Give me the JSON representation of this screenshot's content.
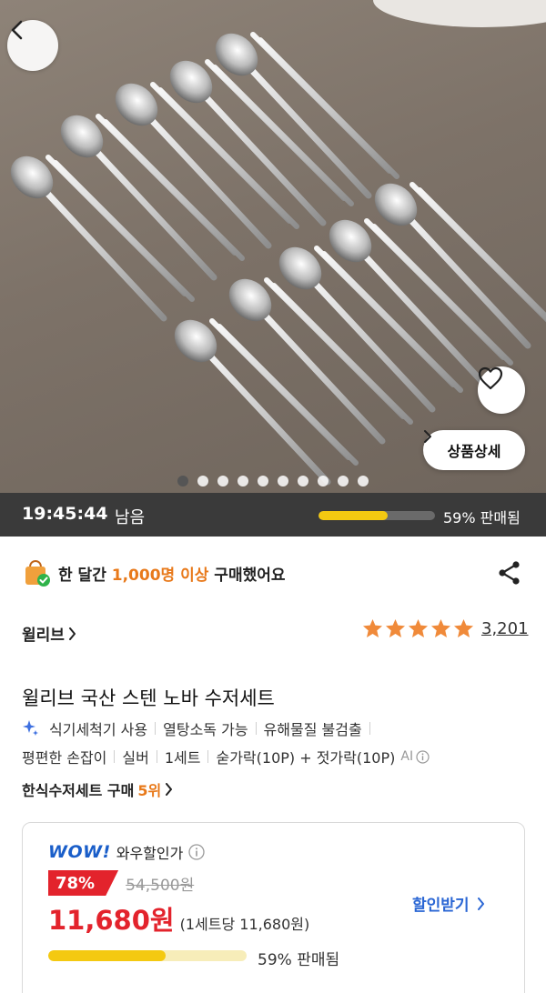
{
  "hero": {
    "image_alt": "stainless spoon and chopstick sets",
    "carousel_total": 10,
    "carousel_active": 0,
    "detail_button": "상품상세"
  },
  "timer": {
    "time": "19:45:44",
    "remain_label": "남음",
    "sold_fraction": 0.59,
    "sold_text": "59% 판매됨"
  },
  "purchase": {
    "prefix": "한 달간 ",
    "highlight": "1,000명 이상",
    "suffix": " 구매했어요"
  },
  "brand": {
    "name": "윌리브"
  },
  "rating": {
    "stars": 5,
    "count": "3,201"
  },
  "product": {
    "title": "윌리브 국산 스텐 노바 수저세트",
    "features_line1": [
      "식기세척기 사용",
      "열탕소독 가능",
      "유해물질 불검출"
    ],
    "features_line2": [
      "평편한 손잡이",
      "실버",
      "1세트",
      "숟가락(10P) + 젓가락(10P)"
    ],
    "ai_label": "AI",
    "rank_label": "한식수저세트 구매",
    "rank_value": "5위"
  },
  "price": {
    "wow_logo": "WOW!",
    "wow_label": "와우할인가",
    "discount": "78%",
    "original": "54,500원",
    "final": "11,680원",
    "unit": "(1세트당 11,680원)",
    "coupon": "할인받기",
    "sold_fraction": 0.59,
    "sold_text": "59% 판매됨"
  },
  "colors": {
    "accent_orange": "#e8791a",
    "price_red": "#e3232c",
    "coupon_blue": "#2a66d4",
    "progress_yellow": "#f4c911",
    "star": "#f08a3a"
  },
  "icons": [
    "back-arrow-icon",
    "heart-icon",
    "chevron-right-icon",
    "shopping-bag-icon",
    "share-icon",
    "star-icon",
    "info-icon",
    "sparkle-icon"
  ]
}
